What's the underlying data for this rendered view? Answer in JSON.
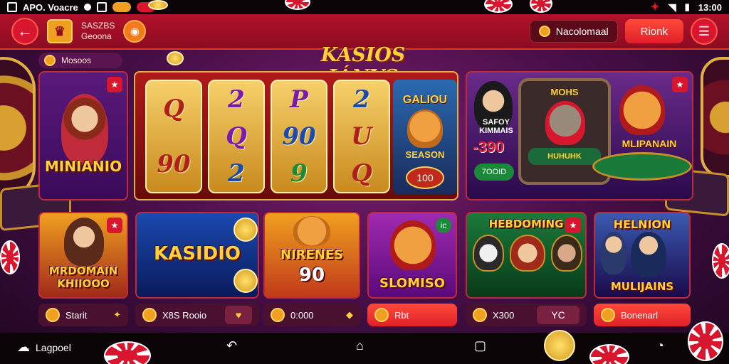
{
  "status_bar": {
    "left_text": "APO. Voacre",
    "time": "13:00"
  },
  "app_bar": {
    "brand_line1": "SASZBS",
    "brand_line2": "Geoona",
    "balance_label": "Nacolomaal",
    "action_label": "Rionk"
  },
  "filter": {
    "label": "Mosoos"
  },
  "banner": {
    "title": "KASIOS IÁNVS"
  },
  "cards": {
    "minianio": {
      "title": "MINIANIO"
    },
    "slot": {
      "reels": [
        "Q",
        "90",
        "2",
        "Q",
        "2",
        "9",
        "P",
        "90",
        "9",
        "2",
        "U",
        "Q"
      ]
    },
    "saloon": {
      "title": "GALIOU",
      "subtitle": "SEASON",
      "badge": "100"
    },
    "lounge": {
      "left_text": "SAFOY KIMMAIS",
      "big_number": "-390",
      "left_badge": "7OOID",
      "sign": "MOHS",
      "table_text": "HUHUHK",
      "title": "MLIPANAIN"
    },
    "mrdomain": {
      "title": "MRDOMAIN KHIIOOO"
    },
    "kasidio": {
      "title": "KASIDIO"
    },
    "nirenes": {
      "title": "NIRENES",
      "number": "90"
    },
    "slomiso": {
      "title": "SLOMISO",
      "badge": "ic"
    },
    "hebdoming": {
      "title": "HEBDOMING"
    },
    "helmion": {
      "title": "HELNION",
      "subtitle": "MULIJAINS"
    }
  },
  "actions": [
    {
      "label": "Starit"
    },
    {
      "label": "X8S Rooio"
    },
    {
      "label": "0:000"
    },
    {
      "label": "Rbt"
    },
    {
      "label": "X300",
      "extra": "YC"
    },
    {
      "label": "Bonenarl"
    }
  ],
  "bottom_nav": {
    "left_label": "Lagpoel"
  }
}
